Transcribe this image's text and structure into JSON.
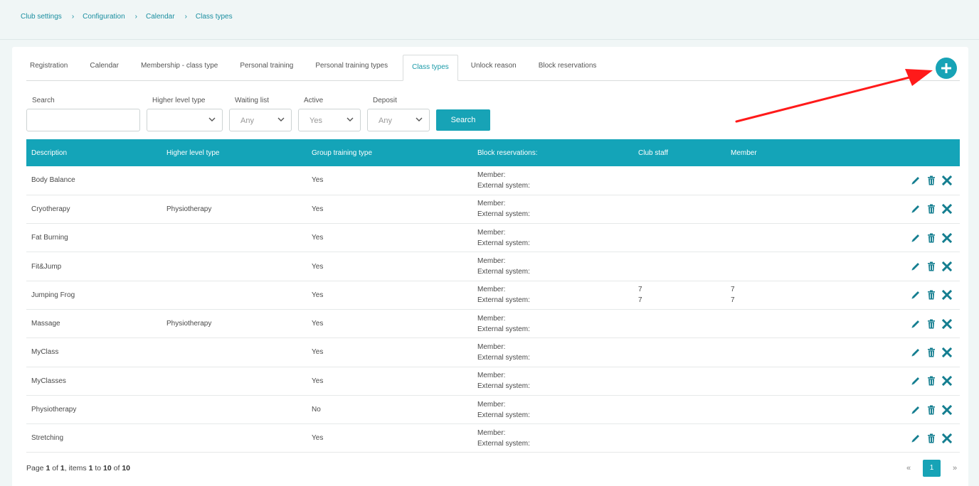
{
  "breadcrumb": [
    "Club settings",
    "Configuration",
    "Calendar",
    "Class types"
  ],
  "tabs": [
    "Registration",
    "Calendar",
    "Membership - class type",
    "Personal training",
    "Personal training types",
    "Class types",
    "Unlock reason",
    "Block reservations"
  ],
  "active_tab": "Class types",
  "add_icon": "plus-icon",
  "filters": {
    "search_label": "Search",
    "search_value": "",
    "higher_level_label": "Higher level type",
    "higher_level_value": "",
    "waiting_list_label": "Waiting list",
    "waiting_list_value": "Any",
    "active_label": "Active",
    "active_value": "Yes",
    "deposit_label": "Deposit",
    "deposit_value": "Any",
    "search_button": "Search"
  },
  "table": {
    "headers": [
      "Description",
      "Higher level type",
      "Group training type",
      "Block reservations:",
      "Club staff",
      "Member"
    ],
    "block_labels": {
      "member": "Member:",
      "external": "External system:"
    },
    "rows": [
      {
        "description": "Body Balance",
        "higher": "",
        "group": "Yes",
        "staff1": "",
        "staff2": "",
        "member1": "",
        "member2": ""
      },
      {
        "description": "Cryotherapy",
        "higher": "Physiotherapy",
        "group": "Yes",
        "staff1": "",
        "staff2": "",
        "member1": "",
        "member2": ""
      },
      {
        "description": "Fat Burning",
        "higher": "",
        "group": "Yes",
        "staff1": "",
        "staff2": "",
        "member1": "",
        "member2": ""
      },
      {
        "description": "Fit&Jump",
        "higher": "",
        "group": "Yes",
        "staff1": "",
        "staff2": "",
        "member1": "",
        "member2": ""
      },
      {
        "description": "Jumping Frog",
        "higher": "",
        "group": "Yes",
        "staff1": "7",
        "staff2": "7",
        "member1": "7",
        "member2": "7"
      },
      {
        "description": "Massage",
        "higher": "Physiotherapy",
        "group": "Yes",
        "staff1": "",
        "staff2": "",
        "member1": "",
        "member2": ""
      },
      {
        "description": "MyClass",
        "higher": "",
        "group": "Yes",
        "staff1": "",
        "staff2": "",
        "member1": "",
        "member2": ""
      },
      {
        "description": "MyClasses",
        "higher": "",
        "group": "Yes",
        "staff1": "",
        "staff2": "",
        "member1": "",
        "member2": ""
      },
      {
        "description": "Physiotherapy",
        "higher": "",
        "group": "No",
        "staff1": "",
        "staff2": "",
        "member1": "",
        "member2": ""
      },
      {
        "description": "Stretching",
        "higher": "",
        "group": "Yes",
        "staff1": "",
        "staff2": "",
        "member1": "",
        "member2": ""
      }
    ],
    "row_actions": [
      "pencil-icon",
      "trash-icon",
      "close-icon"
    ]
  },
  "pagination": {
    "page_word": "Page",
    "current": "1",
    "of_word": "of",
    "total_pages": "1",
    "items_word": ", items",
    "from": "1",
    "to_word": "to",
    "to": "10",
    "total_items": "10",
    "prev": "«",
    "next": "»",
    "page_button": "1"
  },
  "colors": {
    "accent": "#17a3b6",
    "header": "#14a4b8",
    "annotation_arrow": "#ff1a1a"
  }
}
